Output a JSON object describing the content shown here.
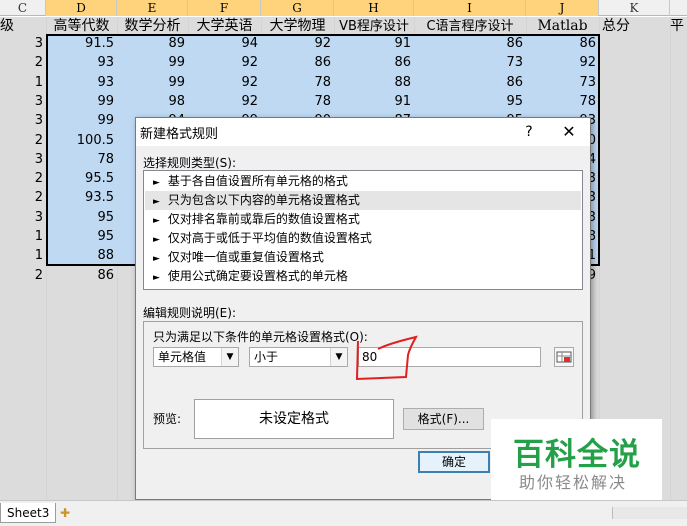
{
  "sheet": {
    "column_headers": [
      "C",
      "D",
      "E",
      "F",
      "G",
      "H",
      "I",
      "J",
      "K"
    ],
    "header_row": [
      "级",
      "高等代数",
      "数学分析",
      "大学英语",
      "大学物理",
      "VB程序设计",
      "C语言程序设计",
      "Matlab",
      "总分",
      "平"
    ],
    "col_c_values": [
      "3",
      "2",
      "1",
      "3",
      "3",
      "2",
      "3",
      "2",
      "2",
      "3",
      "1",
      "1",
      "2"
    ],
    "rows": [
      [
        "91.5",
        "89",
        "94",
        "92",
        "91",
        "86",
        "86"
      ],
      [
        "93",
        "99",
        "92",
        "86",
        "86",
        "73",
        "92"
      ],
      [
        "93",
        "99",
        "92",
        "78",
        "88",
        "86",
        "73"
      ],
      [
        "99",
        "98",
        "92",
        "78",
        "91",
        "95",
        "78"
      ],
      [
        "99",
        "94",
        "99",
        "90",
        "87",
        "95",
        "93"
      ],
      [
        "100.5",
        "",
        "",
        "",
        "",
        "",
        "0"
      ],
      [
        "78",
        "",
        "",
        "",
        "",
        "",
        "4"
      ],
      [
        "95.5",
        "",
        "",
        "",
        "",
        "",
        "3"
      ],
      [
        "93.5",
        "",
        "",
        "",
        "",
        "",
        "3"
      ],
      [
        "95",
        "",
        "",
        "",
        "",
        "",
        "3"
      ],
      [
        "95",
        "",
        "",
        "",
        "",
        "",
        "8"
      ],
      [
        "88",
        "",
        "",
        "",
        "",
        "",
        "1"
      ],
      [
        "86",
        "",
        "",
        "",
        "",
        "",
        "9"
      ]
    ],
    "tab": "Sheet3"
  },
  "dialog": {
    "title": "新建格式规则",
    "help": "?",
    "close": "✕",
    "rule_type_label": "选择规则类型(S):",
    "rule_types": [
      "基于各自值设置所有单元格的格式",
      "只为包含以下内容的单元格设置格式",
      "仅对排名靠前或靠后的数值设置格式",
      "仅对高于或低于平均值的数值设置格式",
      "仅对唯一值或重复值设置格式",
      "使用公式确定要设置格式的单元格"
    ],
    "selected_rule_index": 1,
    "edit_desc_label": "编辑规则说明(E):",
    "condition_label": "只为满足以下条件的单元格设置格式(O):",
    "combo_type": "单元格值",
    "combo_operator": "小于",
    "value": "80",
    "preview_label": "预览:",
    "preview_text": "未设定格式",
    "format_button": "格式(F)...",
    "ok_button": "确定",
    "cancel_button": "取消"
  },
  "watermark": {
    "title": "百科全说",
    "subtitle": "助你轻松解决"
  }
}
